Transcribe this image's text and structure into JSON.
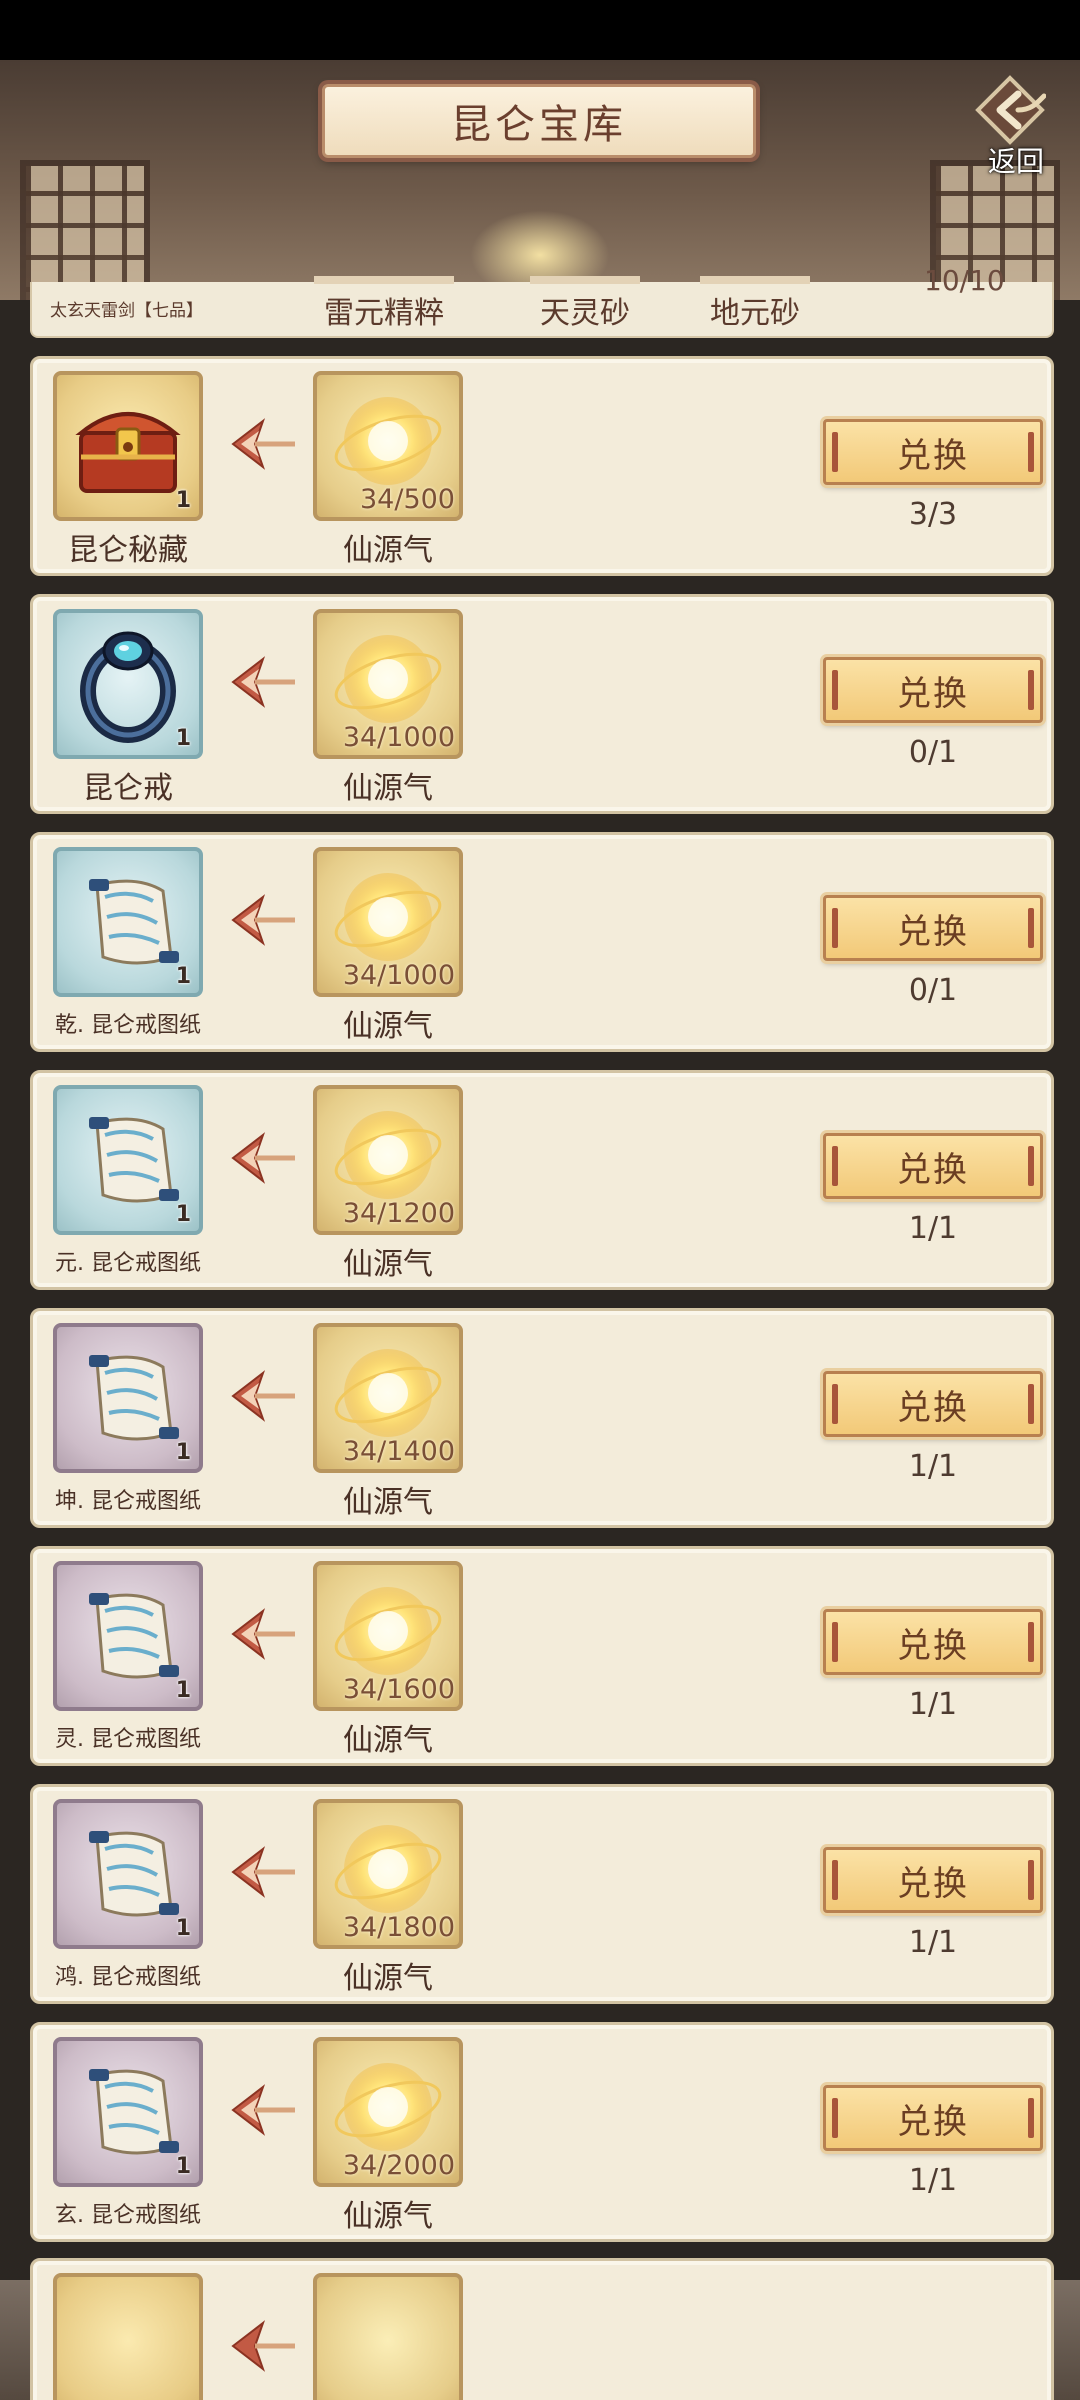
{
  "header": {
    "title": "昆仑宝库",
    "back_label": "返回"
  },
  "partial_card": {
    "item_name": "太玄天雷剑【七品】",
    "materials": [
      "雷元精粹",
      "天灵砂",
      "地元砂"
    ],
    "count": "10/10"
  },
  "exchange": {
    "button_label": "兑换",
    "currency_name": "仙源气",
    "items": [
      {
        "name": "昆仑秘藏",
        "qty": "1",
        "rarity": "gold",
        "icon": "treasure-chest-icon",
        "cost": "34/500",
        "limit": "3/3"
      },
      {
        "name": "昆仑戒",
        "qty": "1",
        "rarity": "blue",
        "icon": "ring-icon",
        "cost": "34/1000",
        "limit": "0/1"
      },
      {
        "name": "乾. 昆仑戒图纸",
        "qty": "1",
        "rarity": "blue",
        "icon": "scroll-blueprint-icon",
        "cost": "34/1000",
        "limit": "0/1"
      },
      {
        "name": "元. 昆仑戒图纸",
        "qty": "1",
        "rarity": "blue",
        "icon": "scroll-blueprint-icon",
        "cost": "34/1200",
        "limit": "1/1"
      },
      {
        "name": "坤. 昆仑戒图纸",
        "qty": "1",
        "rarity": "purple",
        "icon": "scroll-blueprint-icon",
        "cost": "34/1400",
        "limit": "1/1"
      },
      {
        "name": "灵. 昆仑戒图纸",
        "qty": "1",
        "rarity": "purple",
        "icon": "scroll-blueprint-icon",
        "cost": "34/1600",
        "limit": "1/1"
      },
      {
        "name": "鸿. 昆仑戒图纸",
        "qty": "1",
        "rarity": "purple",
        "icon": "scroll-blueprint-icon",
        "cost": "34/1800",
        "limit": "1/1"
      },
      {
        "name": "玄. 昆仑戒图纸",
        "qty": "1",
        "rarity": "purple",
        "icon": "scroll-blueprint-icon",
        "cost": "34/2000",
        "limit": "1/1"
      }
    ]
  },
  "colors": {
    "card_bg": "#f3ecda",
    "button_bg": "#f2c978",
    "title_text": "#6b3f2e"
  }
}
